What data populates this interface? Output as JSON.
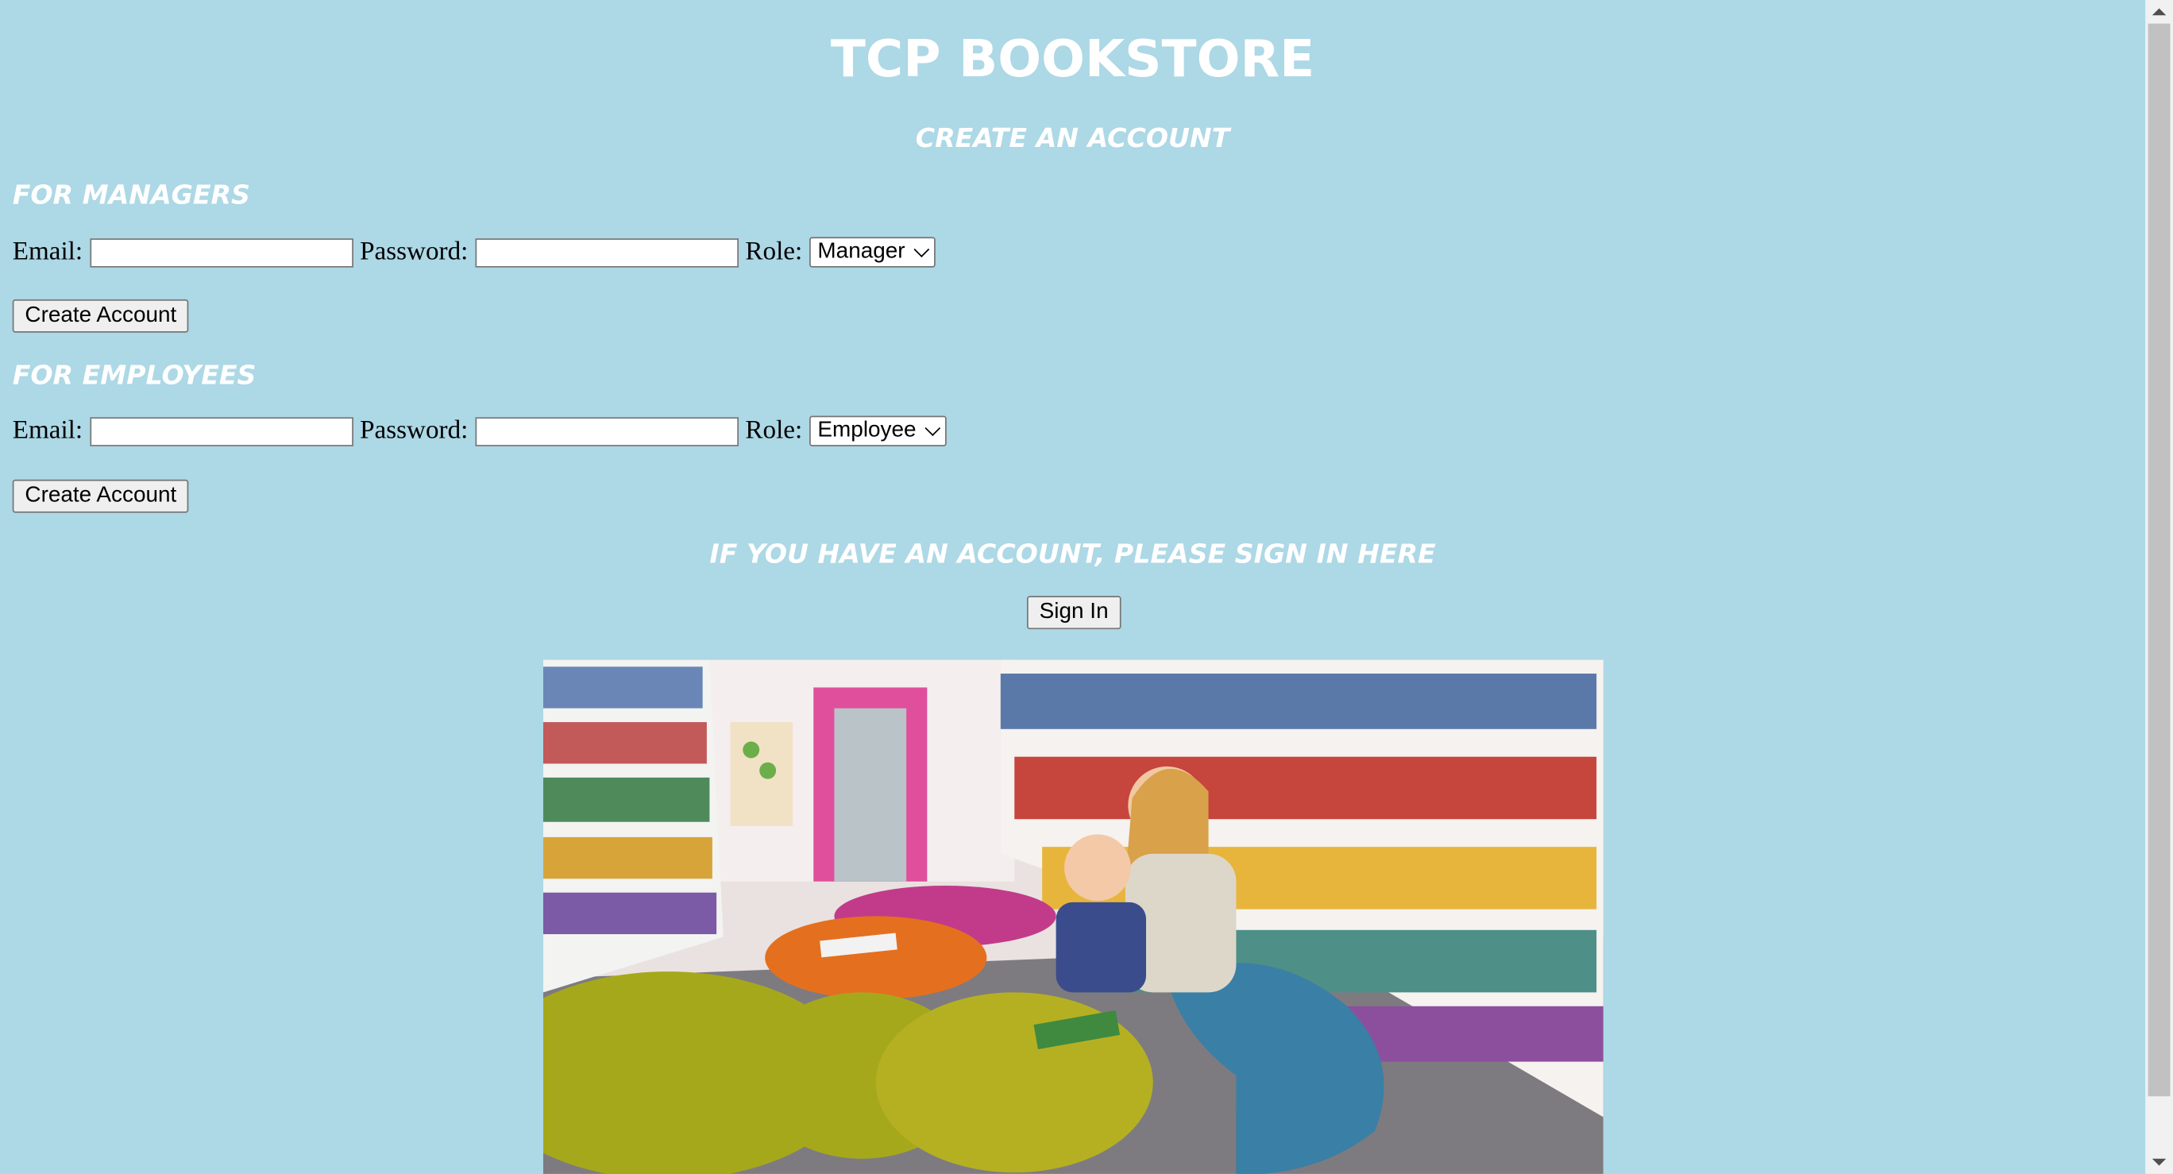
{
  "page": {
    "title": "TCP BOOKSTORE",
    "subtitle": "CREATE AN ACCOUNT"
  },
  "managers": {
    "heading": "FOR MANAGERS",
    "email_label": "Email:",
    "email_value": "",
    "password_label": "Password:",
    "password_value": "",
    "role_label": "Role:",
    "role_selected": "Manager",
    "submit_label": "Create Account"
  },
  "employees": {
    "heading": "FOR EMPLOYEES",
    "email_label": "Email:",
    "email_value": "",
    "password_label": "Password:",
    "password_value": "",
    "role_label": "Role:",
    "role_selected": "Employee",
    "submit_label": "Create Account"
  },
  "signin": {
    "heading": "IF YOU HAVE AN ACCOUNT, PLEASE SIGN IN HERE",
    "button_label": "Sign In"
  },
  "colors": {
    "background": "#add8e6",
    "heading_text": "#ffffff"
  }
}
